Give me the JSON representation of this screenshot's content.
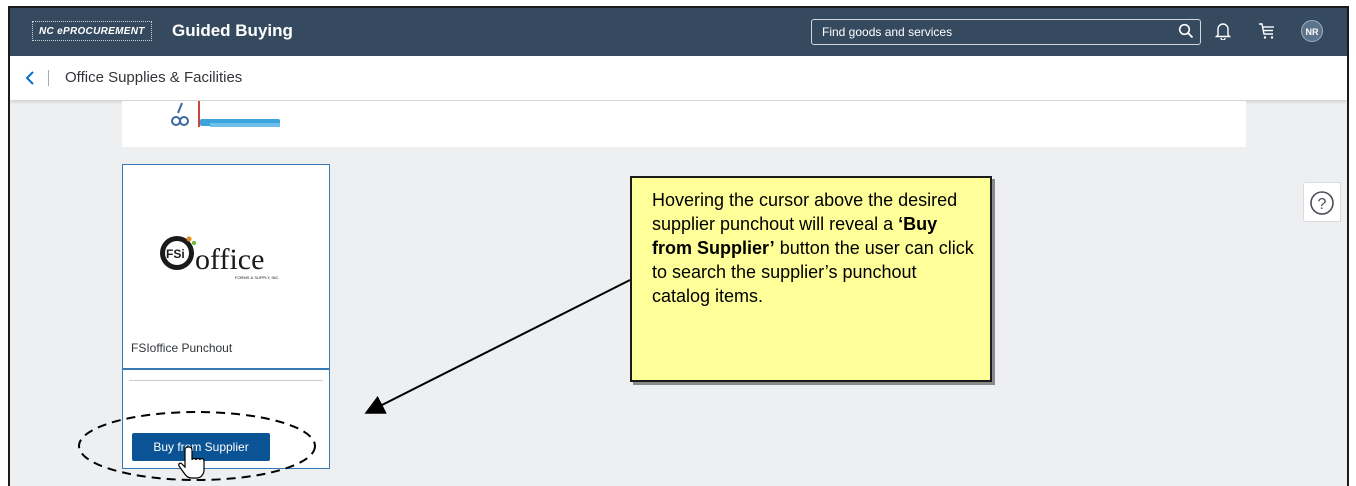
{
  "shell": {
    "logo_text": "NC ePROCUREMENT",
    "app_title": "Guided Buying",
    "search_placeholder": "Find goods and services",
    "avatar_initials": "NR",
    "colors": {
      "shell_bg": "#354a5f",
      "button_blue": "#0a5394",
      "callout_bg": "#ffff99"
    }
  },
  "subheader": {
    "back_icon": "chevron-left-icon",
    "title": "Office Supplies & Facilities"
  },
  "tile": {
    "logo_word": "office",
    "logo_badge": "FSi",
    "logo_small": "FORMS & SUPPLY, INC.",
    "label": "FSIoffice Punchout",
    "buy_button": "Buy from Supplier"
  },
  "help": {
    "icon": "help-circle-icon",
    "glyph": "?"
  },
  "callout": {
    "text_before": "Hovering the cursor above the desired supplier punchout will reveal a ",
    "text_bold": "‘Buy from Supplier’",
    "text_after": " button the user can click to search the supplier’s punchout catalog items."
  }
}
